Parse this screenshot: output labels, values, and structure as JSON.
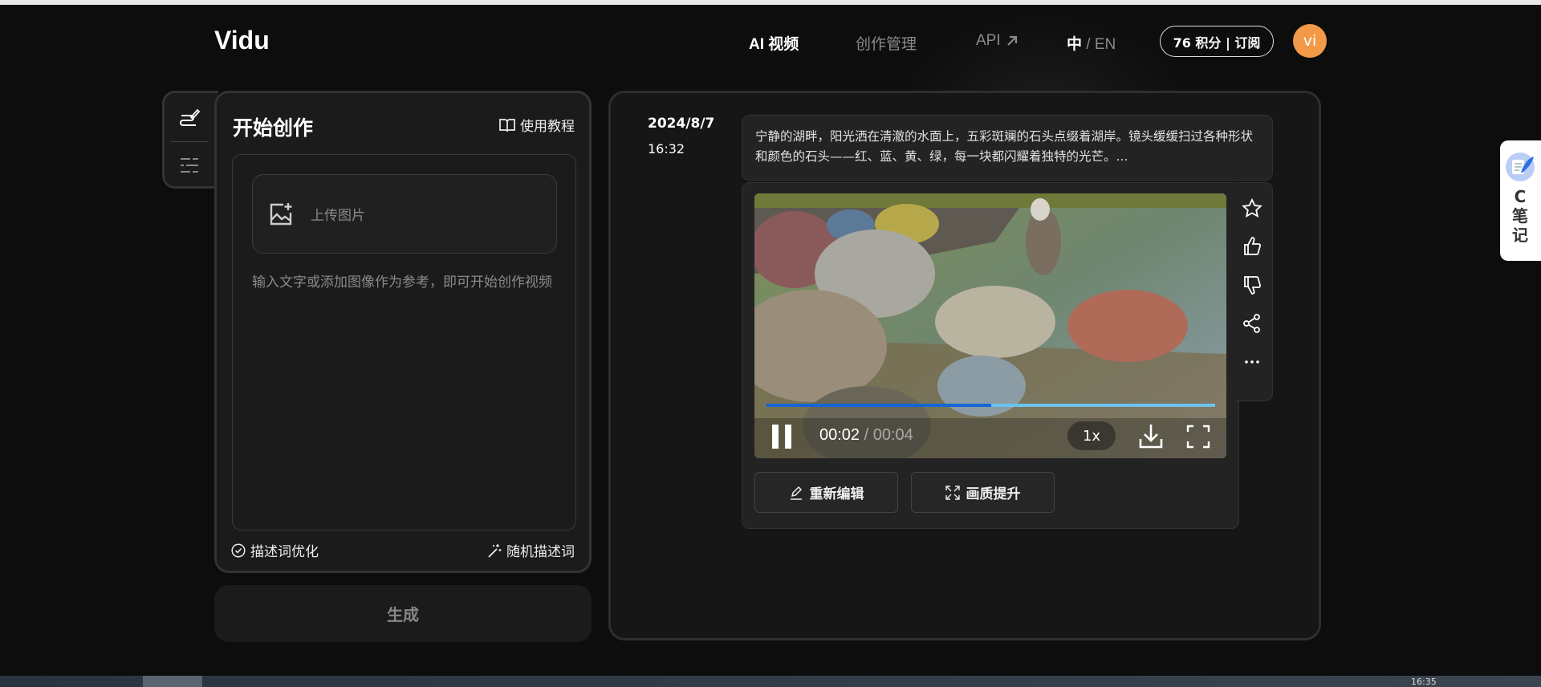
{
  "header": {
    "logo": "Vidu",
    "nav": [
      "AI 视频",
      "创作管理",
      "API"
    ],
    "lang_active": "中",
    "lang_sep": " / ",
    "lang_other": "EN",
    "credits": "76 积分 | 订阅",
    "avatar": "vi"
  },
  "left": {
    "title": "开始创作",
    "tutorial": "使用教程",
    "upload": "上传图片",
    "placeholder": "输入文字或添加图像作为参考，即可开始创作视频",
    "optimize": "描述词优化",
    "random": "随机描述词",
    "generate": "生成"
  },
  "result": {
    "date": "2024/8/7",
    "time": "16:32",
    "prompt": "宁静的湖畔，阳光洒在清澈的水面上，五彩斑斓的石头点缀着湖岸。镜头缓缓扫过各种形状和颜色的石头——红、蓝、黄、绿，每一块都闪耀着独特的光芒。...",
    "current": "00:02",
    "sep": " / ",
    "duration": "00:04",
    "progress": 0.5,
    "speed": "1x",
    "reedit": "重新编辑",
    "upscale": "画质提升"
  },
  "widget": {
    "label": "C笔记"
  },
  "taskbar": {
    "clock": "16:35"
  },
  "colors": {
    "accent": "#1466d4",
    "avatar": "#f39a48"
  }
}
